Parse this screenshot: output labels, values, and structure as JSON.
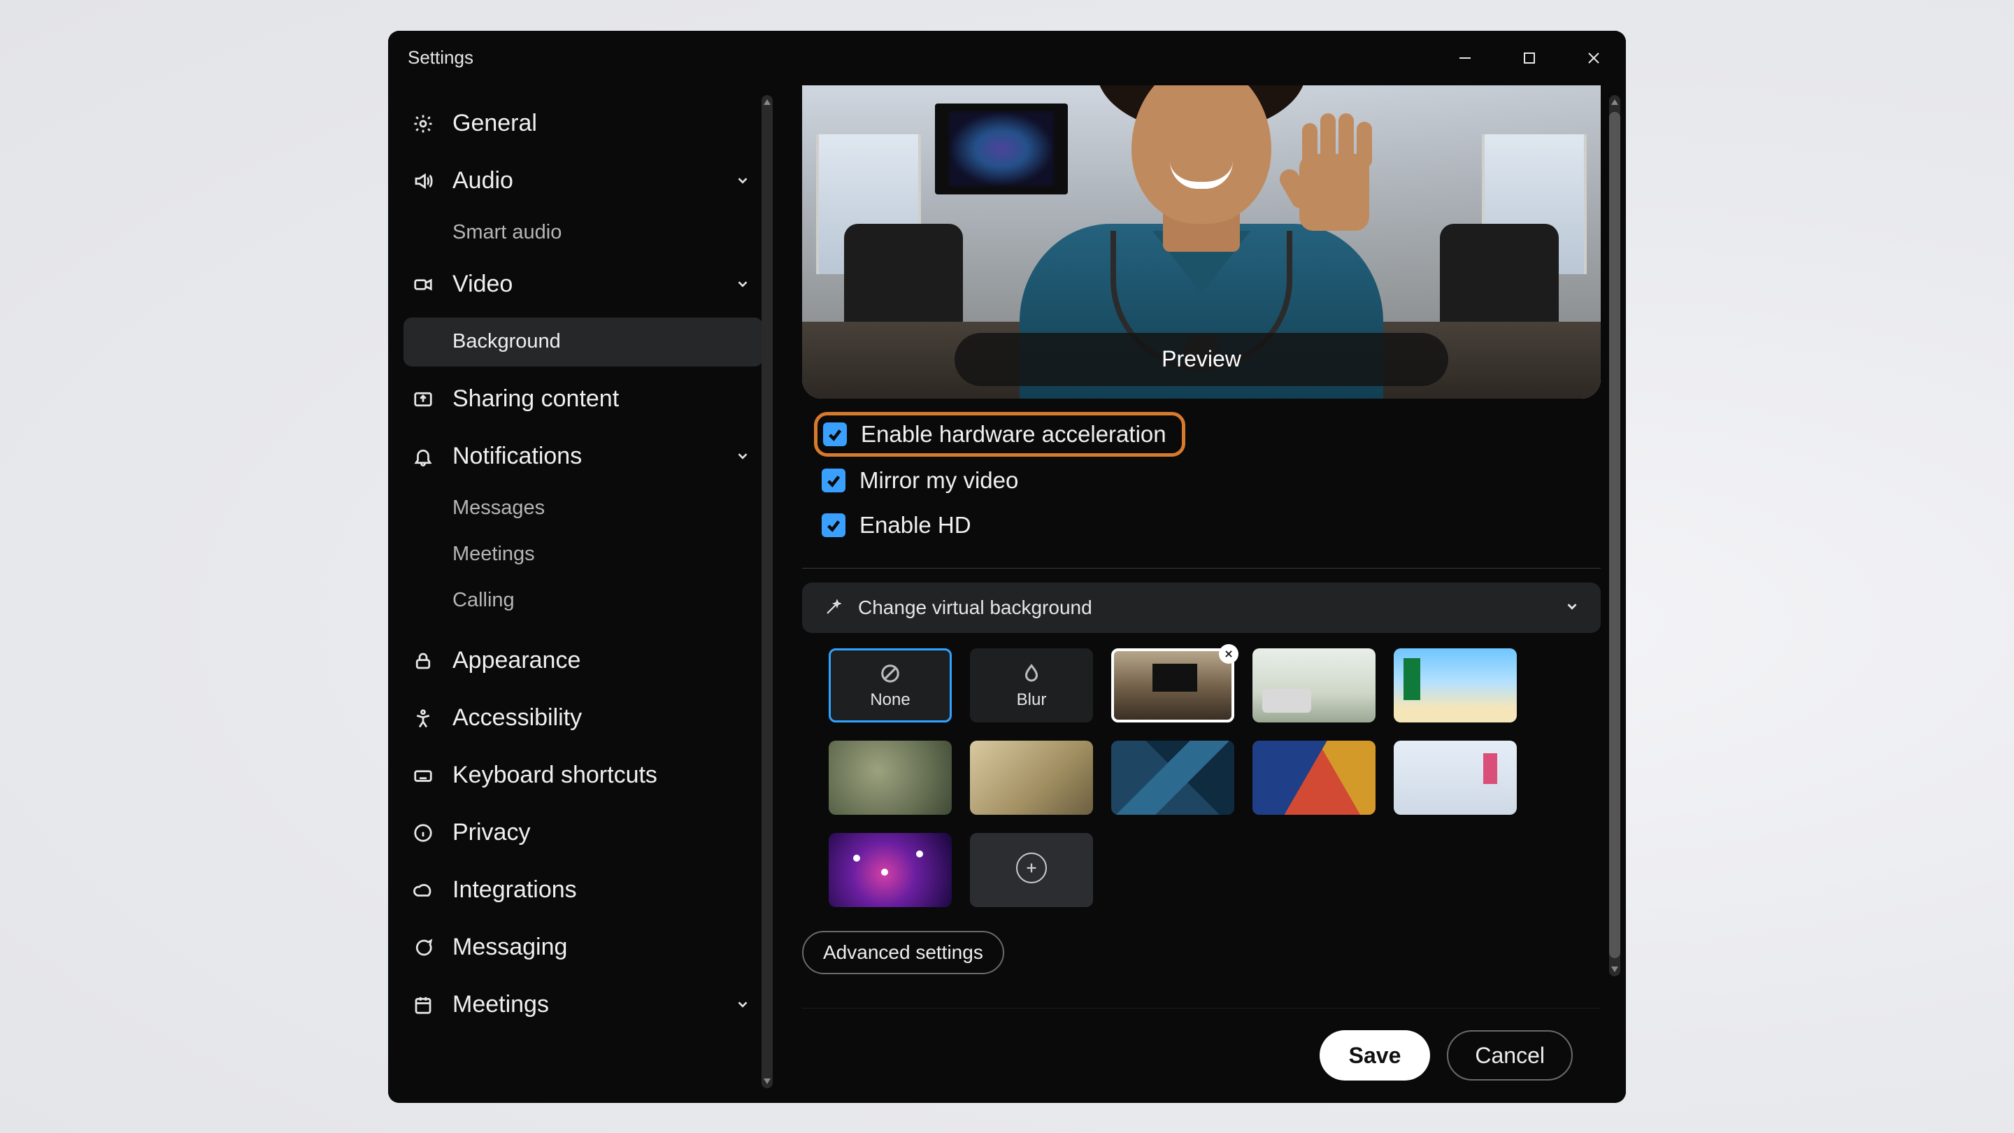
{
  "window": {
    "title": "Settings"
  },
  "sidebar": {
    "general": "General",
    "audio": "Audio",
    "audio_sub_smart": "Smart audio",
    "video": "Video",
    "video_sub_background": "Background",
    "sharing": "Sharing content",
    "notifications": "Notifications",
    "notif_sub_messages": "Messages",
    "notif_sub_meetings": "Meetings",
    "notif_sub_calling": "Calling",
    "appearance": "Appearance",
    "accessibility": "Accessibility",
    "keyboard": "Keyboard shortcuts",
    "privacy": "Privacy",
    "integrations": "Integrations",
    "messaging": "Messaging",
    "meetings": "Meetings"
  },
  "preview": {
    "button": "Preview"
  },
  "checks": {
    "hw_accel": {
      "label": "Enable hardware acceleration",
      "checked": true,
      "highlighted": true
    },
    "mirror": {
      "label": "Mirror my video",
      "checked": true
    },
    "hd": {
      "label": "Enable HD",
      "checked": true
    }
  },
  "virtual_bg": {
    "panel_title": "Change virtual background",
    "none_label": "None",
    "blur_label": "Blur"
  },
  "adv_settings": "Advanced settings",
  "footer": {
    "save": "Save",
    "cancel": "Cancel"
  }
}
